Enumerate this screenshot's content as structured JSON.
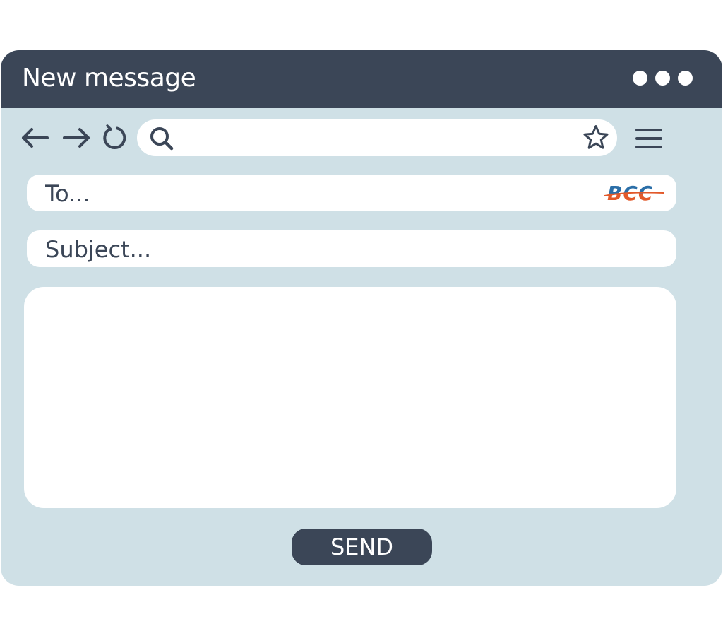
{
  "window": {
    "title": "New message"
  },
  "toolbar": {
    "address_value": ""
  },
  "compose": {
    "to_placeholder": "To...",
    "bcc_label": "BCC",
    "subject_placeholder": "Subject...",
    "body_value": "",
    "send_label": "SEND"
  },
  "colors": {
    "titlebar": "#3b4657",
    "window_background": "#cfe0e6",
    "field_background": "#ffffff",
    "bcc_blue": "#2b6fa8",
    "bcc_orange": "#e2592a"
  },
  "icons": [
    "more-dots-icon",
    "back-arrow-icon",
    "forward-arrow-icon",
    "refresh-icon",
    "search-icon",
    "star-icon",
    "menu-icon"
  ]
}
